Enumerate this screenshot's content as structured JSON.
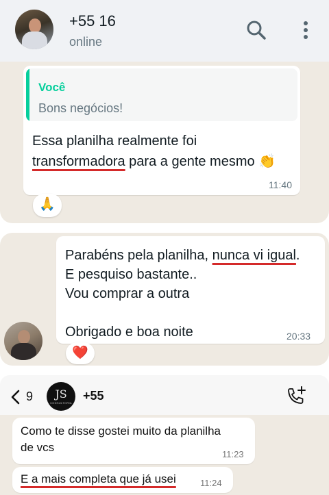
{
  "colors": {
    "chat_background": "#efeae2",
    "header_background": "#f0f2f5",
    "quote_accent": "#06cf9c",
    "underline": "#d42a2a",
    "bubble": "#ffffff"
  },
  "chat1": {
    "contact_name": "+55 16",
    "status": "online",
    "header_icons": [
      "search-icon",
      "more-vertical-icon"
    ],
    "message": {
      "quote_author": "Você",
      "quote_text": "Bons negócios!",
      "line1": "Essa planilha realmente foi",
      "line2_underlined": "transformadora",
      "line2_rest": " para a gente mesmo 👏",
      "time": "11:40"
    },
    "reaction": "🙏"
  },
  "chat2": {
    "message": {
      "line1_plain": "Parabéns pela planilha, ",
      "line1_underlined": "nunca vi igual",
      "line1_end": ".",
      "line2": "E pesquiso bastante..",
      "line3": "Vou comprar a outra",
      "line4": "Obrigado e boa noite",
      "time": "20:33"
    },
    "reaction": "❤️"
  },
  "chat3": {
    "back_count": "9",
    "contact_name": "+55",
    "logo_letters": "JS",
    "logo_subtitle": "CONSULTORIA",
    "messages": [
      {
        "line1": "Como te disse gostei muito da planilha",
        "line2": "de vcs",
        "time": "11:23"
      },
      {
        "text_underlined": "E a mais completa que já usei",
        "time": "11:24"
      }
    ]
  }
}
